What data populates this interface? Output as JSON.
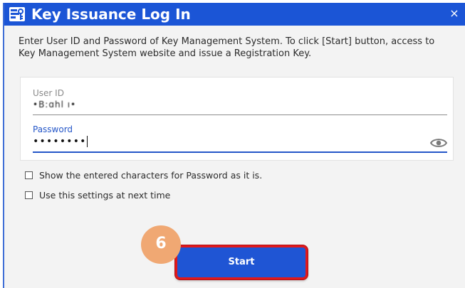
{
  "window": {
    "title": "Key Issuance Log In",
    "close_glyph": "×",
    "app_icon": "key-issuance-app-icon"
  },
  "instructions": "Enter User ID and Password of Key Management System. To click [Start] button, access to Key Management System website and issue a Registration Key.",
  "form": {
    "user_id": {
      "label": "User ID",
      "value": "•B:ɑhl ı•"
    },
    "password": {
      "label": "Password",
      "value": "••••••••",
      "reveal_icon": "eye-icon"
    }
  },
  "options": {
    "show_password": {
      "label": "Show the entered characters for Password as it is.",
      "checked": false
    },
    "remember_settings": {
      "label": "Use this settings at next time",
      "checked": false
    }
  },
  "start_button": {
    "label": "Start"
  },
  "annotation": {
    "step_number": "6"
  },
  "colors": {
    "title_bar": "#1b55d6",
    "button": "#1f55d4",
    "highlight_border": "#e0191c",
    "badge": "#f0a873",
    "focus_accent": "#2456c8"
  }
}
